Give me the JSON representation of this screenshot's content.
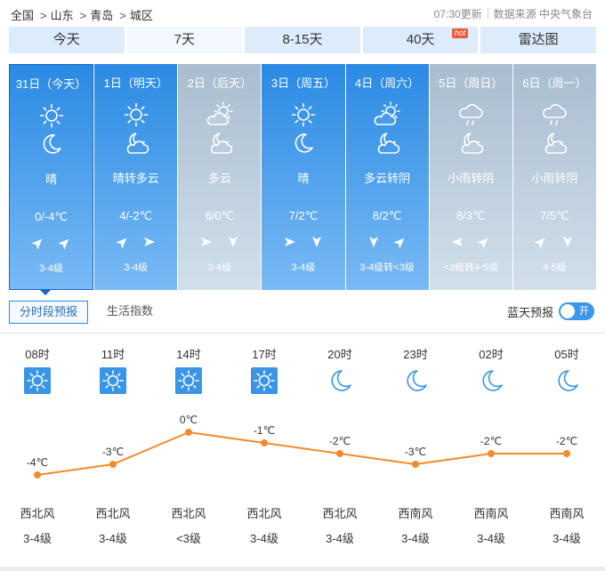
{
  "breadcrumb": [
    "全国",
    "山东",
    "青岛",
    "城区"
  ],
  "breadcrumb_sep": ">",
  "update_time": "07:30更新",
  "data_source": "数据来源 中央气象台",
  "tabs": [
    {
      "label": "今天"
    },
    {
      "label": "7天"
    },
    {
      "label": "8-15天"
    },
    {
      "label": "40天",
      "badge": "hot"
    },
    {
      "label": "雷达图"
    }
  ],
  "days": [
    {
      "title": "31日（今天）",
      "icon1": "sun",
      "icon2": "moon",
      "weather": "晴",
      "temp": "0/-4℃",
      "wind_dir": [
        "NE-arrow",
        "NE-arrow"
      ],
      "wind_level": "3-4级",
      "theme": "blue"
    },
    {
      "title": "1日（明天）",
      "icon1": "sun",
      "icon2": "cloudy-night",
      "weather": "晴转多云",
      "temp": "4/-2℃",
      "wind_dir": [
        "NE-arrow",
        "E-arrow"
      ],
      "wind_level": "3-4级",
      "theme": "blue"
    },
    {
      "title": "2日（后天）",
      "icon1": "partly-cloudy-day",
      "icon2": "cloudy-night",
      "weather": "多云",
      "temp": "6/0℃",
      "wind_dir": [
        "E-arrow",
        "S-arrow"
      ],
      "wind_level": "3-4级",
      "theme": "gray"
    },
    {
      "title": "3日（周五）",
      "icon1": "sun",
      "icon2": "moon",
      "weather": "晴",
      "temp": "7/2℃",
      "wind_dir": [
        "E-arrow",
        "S-arrow"
      ],
      "wind_level": "3-4级",
      "theme": "blue"
    },
    {
      "title": "4日（周六）",
      "icon1": "partly-cloudy-day",
      "icon2": "cloudy-night",
      "weather": "多云转阴",
      "temp": "8/2℃",
      "wind_dir": [
        "S-arrow",
        "NE-arrow"
      ],
      "wind_level": "3-4级转<3级",
      "theme": "blue"
    },
    {
      "title": "5日（周日）",
      "icon1": "rain",
      "icon2": "cloudy-night",
      "weather": "小雨转阴",
      "temp": "8/3℃",
      "wind_dir": [
        "W-arrow",
        "NE-arrow"
      ],
      "wind_level": "<3级转4-5级",
      "theme": "gray"
    },
    {
      "title": "6日（周一）",
      "icon1": "rain",
      "icon2": "cloudy-night",
      "weather": "小雨转阴",
      "temp": "7/5℃",
      "wind_dir": [
        "NE-arrow",
        "S-arrow"
      ],
      "wind_level": "4-5级",
      "theme": "gray"
    }
  ],
  "subtabs": [
    "分时段预报",
    "生活指数"
  ],
  "bluesky_label": "蓝天预报",
  "toggle_label": "开",
  "colors": {
    "accent": "#2a8ae3",
    "line": "#f08c2c",
    "sun_icon": "#3a95e6"
  },
  "chart_data": {
    "type": "line",
    "x": [
      "08时",
      "11时",
      "14时",
      "17时",
      "20时",
      "23时",
      "02时",
      "05时"
    ],
    "icons": [
      "sun",
      "sun",
      "sun",
      "sun",
      "moon",
      "moon",
      "moon",
      "moon"
    ],
    "values": [
      -4,
      -3,
      0,
      -1,
      -2,
      -3,
      -2,
      -2
    ],
    "labels": [
      "-4℃",
      "-3℃",
      "0℃",
      "-1℃",
      "-2℃",
      "-3℃",
      "-2℃",
      "-2℃"
    ],
    "wind_dir": [
      "西北风",
      "西北风",
      "西北风",
      "西北风",
      "西北风",
      "西南风",
      "西南风",
      "西南风"
    ],
    "wind_level": [
      "3-4级",
      "3-4级",
      "<3级",
      "3-4级",
      "3-4级",
      "3-4级",
      "3-4级",
      "3-4级"
    ]
  }
}
